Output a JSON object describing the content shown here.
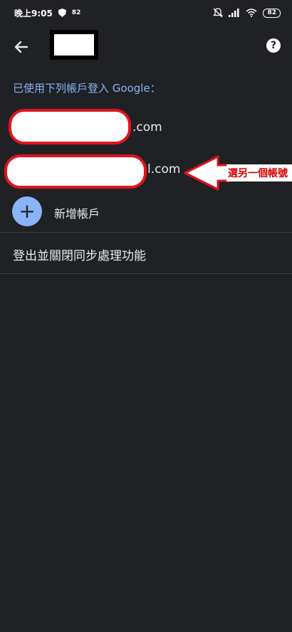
{
  "status_bar": {
    "time": "晚上9:05",
    "notification_count": "82",
    "battery": "82"
  },
  "header": {
    "help_label": "?"
  },
  "signin_label": "已使用下列帳戶登入 Google：",
  "accounts": [
    {
      "email_suffix": ".com"
    },
    {
      "email_suffix": "l.com"
    }
  ],
  "annotation": {
    "label": "選另一個帳號"
  },
  "add_account_label": "新增帳戶",
  "signout_label": "登出並關閉同步處理功能",
  "colors": {
    "background": "#202124",
    "accent": "#8ab4f8",
    "annotation_red": "#e0141e"
  }
}
